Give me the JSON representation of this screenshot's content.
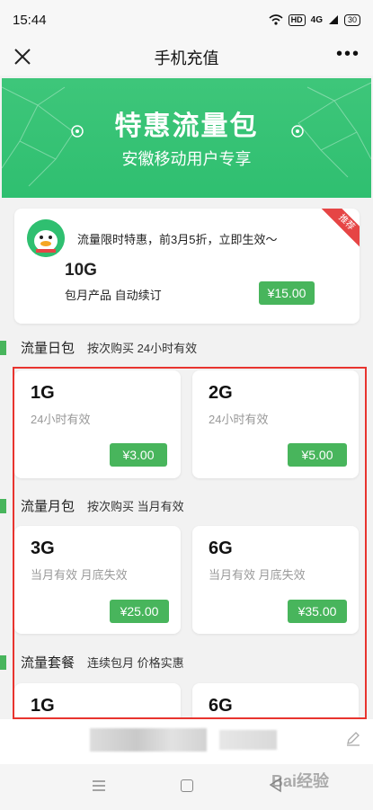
{
  "status": {
    "time": "15:44",
    "hd_label": "HD",
    "net_label": "4G",
    "battery": "30"
  },
  "titlebar": {
    "title": "手机充值"
  },
  "banner": {
    "title": "特惠流量包",
    "subtitle": "安徽移动用户专享"
  },
  "promo": {
    "ribbon": "推荐",
    "text": "流量限时特惠，前3月5折，立即生效～",
    "size": "10G",
    "desc": "包月产品 自动续订",
    "price": "¥15.00"
  },
  "sections": [
    {
      "name": "流量日包",
      "desc": "按次购买 24小时有效",
      "plans": [
        {
          "size": "1G",
          "valid": "24小时有效",
          "price": "¥3.00"
        },
        {
          "size": "2G",
          "valid": "24小时有效",
          "price": "¥5.00"
        }
      ]
    },
    {
      "name": "流量月包",
      "desc": "按次购买 当月有效",
      "plans": [
        {
          "size": "3G",
          "valid": "当月有效 月底失效",
          "price": "¥25.00"
        },
        {
          "size": "6G",
          "valid": "当月有效 月底失效",
          "price": "¥35.00"
        }
      ]
    },
    {
      "name": "流量套餐",
      "desc": "连续包月 价格实惠",
      "plans": [
        {
          "size": "1G"
        },
        {
          "size": "6G"
        }
      ]
    }
  ],
  "watermark": "Bai经验",
  "colors": {
    "accent_green": "#48b55c",
    "banner_green": "#34c274",
    "highlight_red": "#e8342f"
  }
}
